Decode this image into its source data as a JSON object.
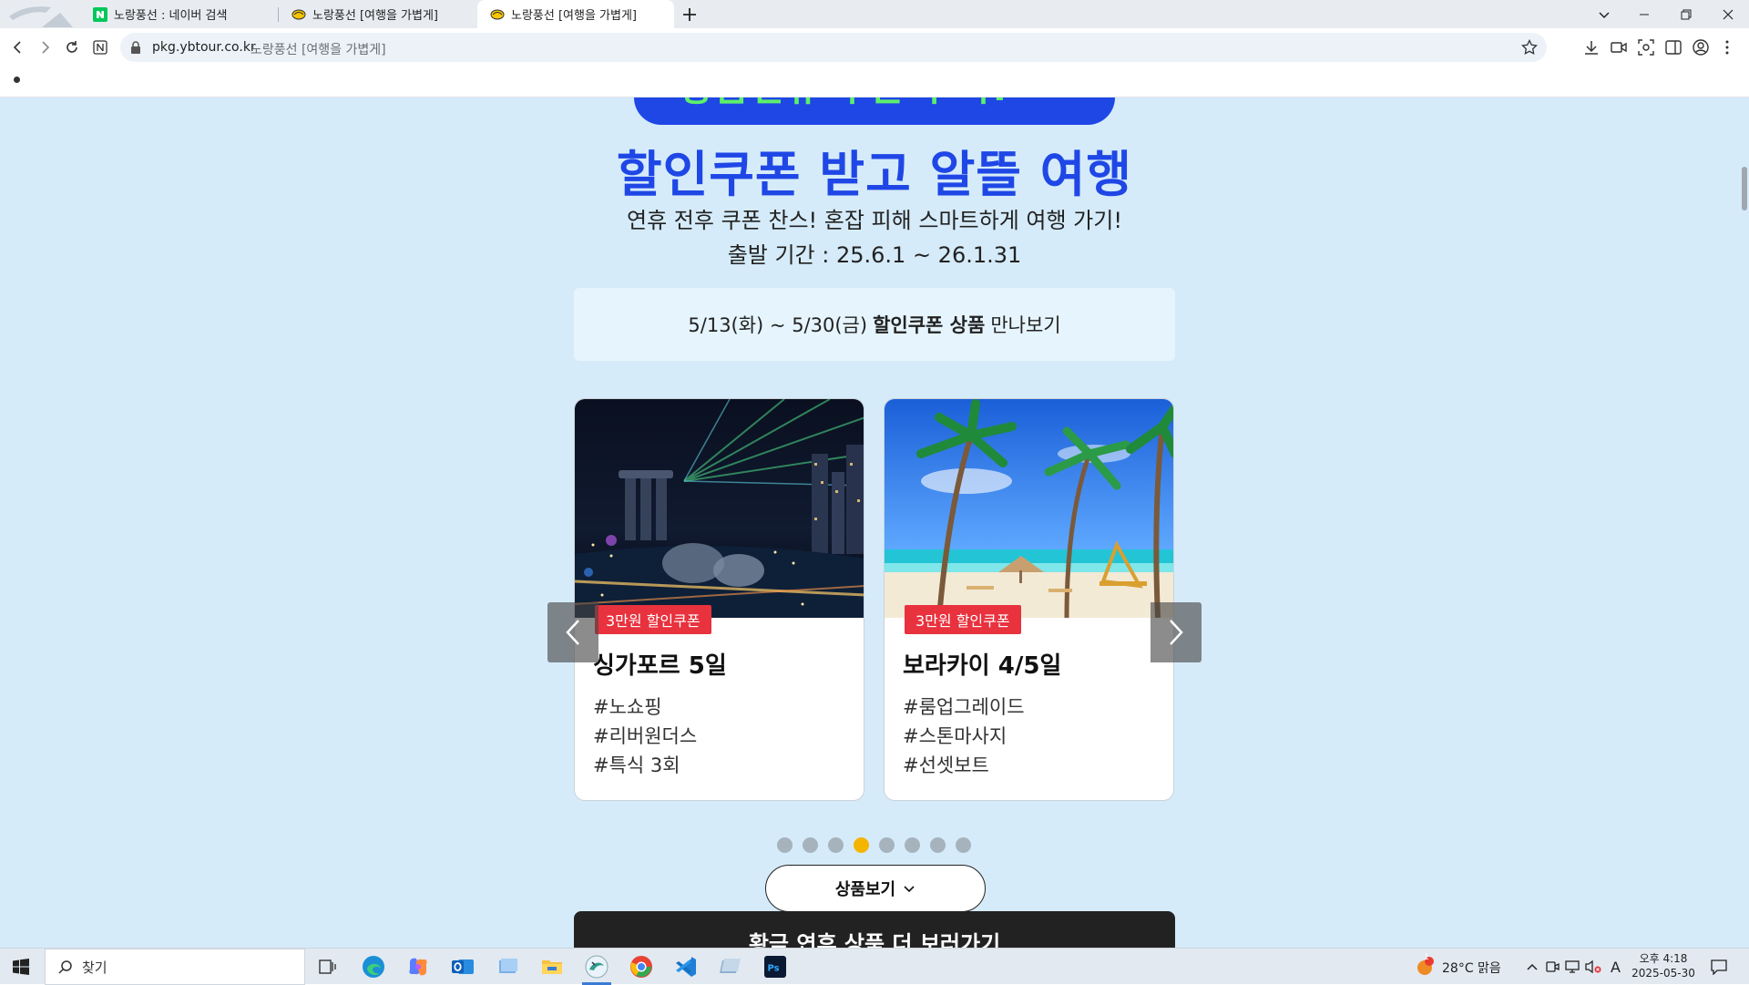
{
  "browser": {
    "tabs": [
      {
        "label": "노랑풍선 : 네이버 검색",
        "favicon": "naver-icon"
      },
      {
        "label": "노랑풍선 [여행을 가볍게]",
        "favicon": "balloon-icon"
      },
      {
        "label": "노랑풍선 [여행을 가볍게]",
        "favicon": "balloon-icon",
        "active": true
      }
    ],
    "url": "pkg.ybtour.co.kr",
    "page_title": "노랑풍선 [여행을 가볍게]"
  },
  "page": {
    "hero_partial": "황금연휴 쿠폰팩 픽!",
    "headline": "할인쿠폰 받고 알뜰 여행",
    "subtitle": "연휴 전후 쿠폰 찬스! 혼잡 피해 스마트하게 여행 가기!",
    "period": "출발 기간 : 25.6.1 ~ 26.1.31",
    "notice": {
      "prefix": "5/13(화) ~ 5/30(금)",
      "bold": "할인쿠폰 상품",
      "suffix": "만나보기"
    },
    "cards": [
      {
        "badge": "3만원 할인쿠폰",
        "title": "싱가포르 5일",
        "tags": [
          "#노쇼핑",
          "#리버원더스",
          "#특식 3회"
        ],
        "image": "singapore-night-photo"
      },
      {
        "badge": "3만원 할인쿠폰",
        "title": "보라카이 4/5일",
        "tags": [
          "#룸업그레이드",
          "#스톤마사지",
          "#선셋보트"
        ],
        "image": "beach-palm-photo"
      }
    ],
    "pagination": {
      "total": 8,
      "active_index": 3
    },
    "more_button": "상품보기",
    "bottom_bar": "황금 연휴 상품 더 보러가기"
  },
  "taskbar": {
    "search_placeholder": "찾기",
    "weather": "28°C  맑음",
    "weather_badge": "1",
    "ime": "A",
    "clock_time": "오후 4:18",
    "clock_date": "2025-05-30"
  },
  "colors": {
    "page_bg": "#d5ebf9",
    "brand_blue": "#1f47e6",
    "badge_red": "#e8323e",
    "dot_active": "#f5b400"
  }
}
